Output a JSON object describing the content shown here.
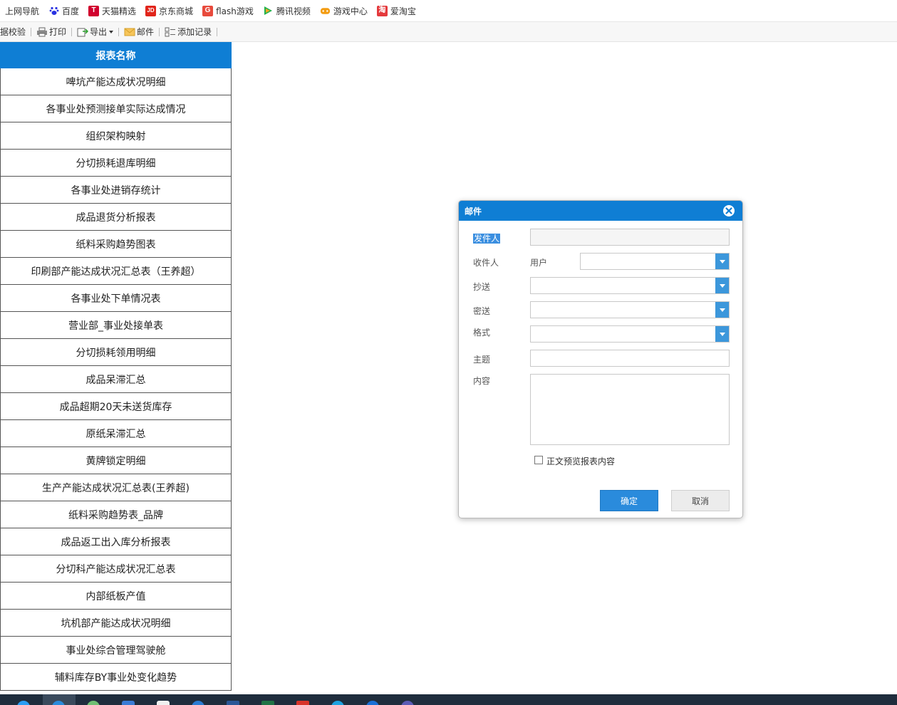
{
  "bookmarks": [
    {
      "label": "上网导航",
      "icon": "none",
      "color": ""
    },
    {
      "label": "百度",
      "icon": "baidu-paw-icon",
      "color": "#2932e1"
    },
    {
      "label": "天猫精选",
      "icon": "tmall-icon",
      "color": "#d1002e"
    },
    {
      "label": "京东商城",
      "icon": "jd-icon",
      "color": "#e1251b"
    },
    {
      "label": "flash游戏",
      "icon": "flash-game-icon",
      "color": "#e84a3c"
    },
    {
      "label": "腾讯视频",
      "icon": "tencent-video-icon",
      "color": "#20b24b"
    },
    {
      "label": "游戏中心",
      "icon": "game-center-icon",
      "color": "#f39c12"
    },
    {
      "label": "爱淘宝",
      "icon": "taobao-icon",
      "color": "#e4393c"
    }
  ],
  "toolbar": {
    "check_label": "据校验",
    "print_label": "打印",
    "export_label": "导出",
    "mail_label": "邮件",
    "add_record_label": "添加记录"
  },
  "table": {
    "header": "报表名称",
    "rows": [
      "啤坑产能达成状况明细",
      "各事业处预测接单实际达成情况",
      "组织架构映射",
      "分切损耗退库明细",
      "各事业处进销存统计",
      "成品退货分析报表",
      "纸料采购趋势图表",
      "印刷部产能达成状况汇总表（王养超）",
      "各事业处下单情况表",
      "营业部_事业处接单表",
      "分切损耗领用明细",
      "成品呆滞汇总",
      "成品超期20天未送货库存",
      "原纸呆滞汇总",
      "黄牌锁定明细",
      "生产产能达成状况汇总表(王养超)",
      "纸料采购趋势表_品牌",
      "成品返工出入库分析报表",
      "分切科产能达成状况汇总表",
      "内部纸板产值",
      "坑机部产能达成状况明细",
      "事业处综合管理驾驶舱",
      "辅料库存BY事业处变化趋势"
    ]
  },
  "dialog": {
    "title": "邮件",
    "sender_label": "发件人",
    "sender_value": "",
    "recipient_label": "收件人",
    "recipient_type": "用户",
    "recipient_value": "",
    "cc_label": "抄送",
    "cc_value": "",
    "bcc_label": "密送",
    "bcc_value": "",
    "format_label": "格式",
    "format_value": "",
    "subject_label": "主题",
    "subject_value": "",
    "content_label": "内容",
    "content_value": "",
    "preview_checkbox_label": "正文预览报表内容",
    "ok_label": "确定",
    "cancel_label": "取消"
  },
  "colors": {
    "accent": "#0f7ed4",
    "taskbar": "#1f2d3d"
  }
}
